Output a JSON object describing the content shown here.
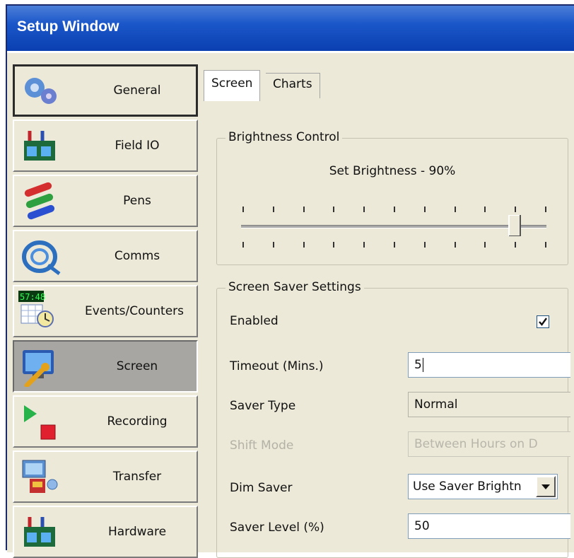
{
  "window": {
    "title": "Setup Window"
  },
  "sidebar": {
    "items": [
      {
        "label": "General",
        "icon": "gears-icon"
      },
      {
        "label": "Field IO",
        "icon": "field-io-icon"
      },
      {
        "label": "Pens",
        "icon": "pens-icon"
      },
      {
        "label": "Comms",
        "icon": "cable-icon"
      },
      {
        "label": "Events/Counters",
        "icon": "events-counters-icon",
        "counter_text": "57:48"
      },
      {
        "label": "Screen",
        "icon": "screen-wrench-icon",
        "active": true
      },
      {
        "label": "Recording",
        "icon": "record-icon"
      },
      {
        "label": "Transfer",
        "icon": "transfer-icon"
      },
      {
        "label": "Hardware",
        "icon": "hardware-icon"
      }
    ]
  },
  "tabs": [
    {
      "label": "Screen",
      "active": true
    },
    {
      "label": "Charts",
      "active": false
    }
  ],
  "brightness": {
    "group_label": "Brightness Control",
    "text": "Set Brightness - 90%",
    "value_percent": 90
  },
  "saver": {
    "group_label": "Screen Saver Settings",
    "enabled_label": "Enabled",
    "enabled_checked": true,
    "timeout_label": "Timeout (Mins.)",
    "timeout_value": "5",
    "type_label": "Saver Type",
    "type_value": "Normal",
    "shift_label": "Shift Mode",
    "shift_value": "Between Hours on D",
    "dim_label": "Dim Saver",
    "dim_value": "Use Saver Brightn",
    "level_label": "Saver Level (%)",
    "level_value": "50"
  },
  "colors": {
    "titlebar": "#1b57c9",
    "panel_bg": "#ece9d8",
    "active_nav": "#a7a6a2"
  }
}
